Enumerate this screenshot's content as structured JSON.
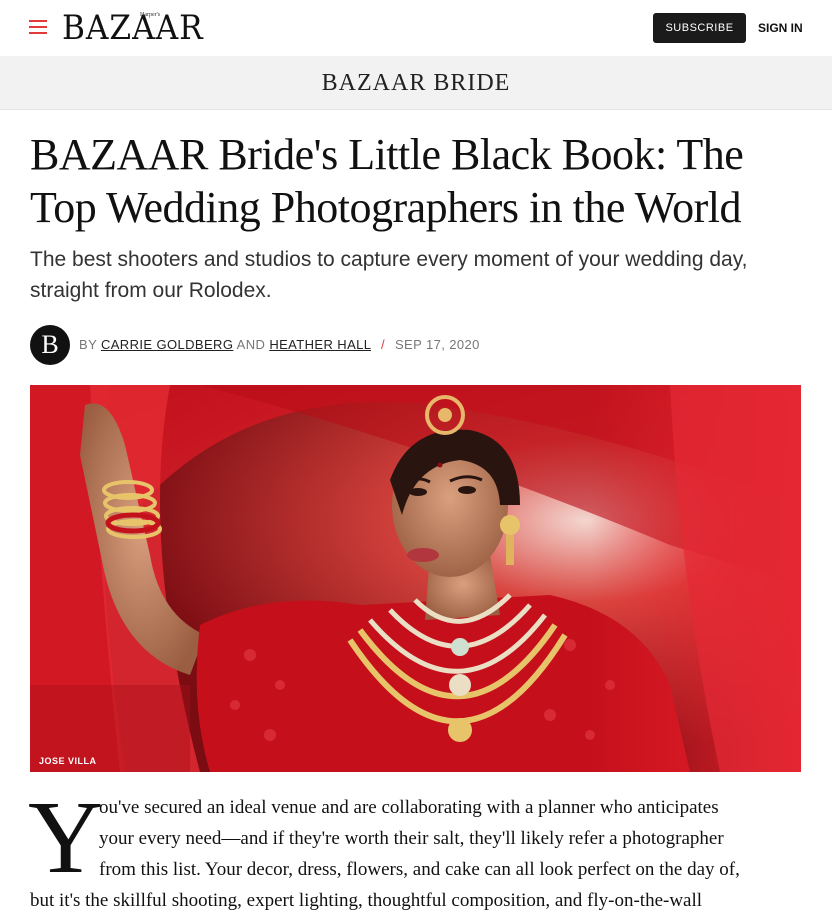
{
  "nav": {
    "logo": "BAZAAR",
    "logo_small": "Harper's",
    "subscribe_label": "SUBSCRIBE",
    "signin_label": "SIGN IN"
  },
  "section": {
    "title": "BAZAAR BRIDE"
  },
  "article": {
    "headline": "BAZAAR Bride's Little Black Book: The Top Wedding Photographers in the World",
    "dek": "The best shooters and studios to capture every moment of your wedding day, straight from our Rolodex.",
    "byline": {
      "avatar_letter": "B",
      "by": "BY",
      "author1": "CARRIE GOLDBERG",
      "and": "AND",
      "author2": "HEATHER HALL",
      "separator": "/",
      "date": "SEP 17, 2020"
    },
    "hero": {
      "credit": "JOSE VILLA"
    },
    "body": {
      "dropcap": "Y",
      "lines": [
        "ou've secured an ideal venue and are collaborating with a planner who anticipates",
        "your every need—and if they're worth their salt, they'll likely refer a photographer",
        "from this list. Your decor, dress, flowers, and cake can all look perfect on the day of,",
        "but it's the skillful shooting, expert lighting, thoughtful composition, and fly-on-the-wall"
      ]
    }
  },
  "colors": {
    "accent_red": "#e03a3a",
    "button_dark": "#1b1b1b",
    "section_bg": "#f2f2f2"
  }
}
